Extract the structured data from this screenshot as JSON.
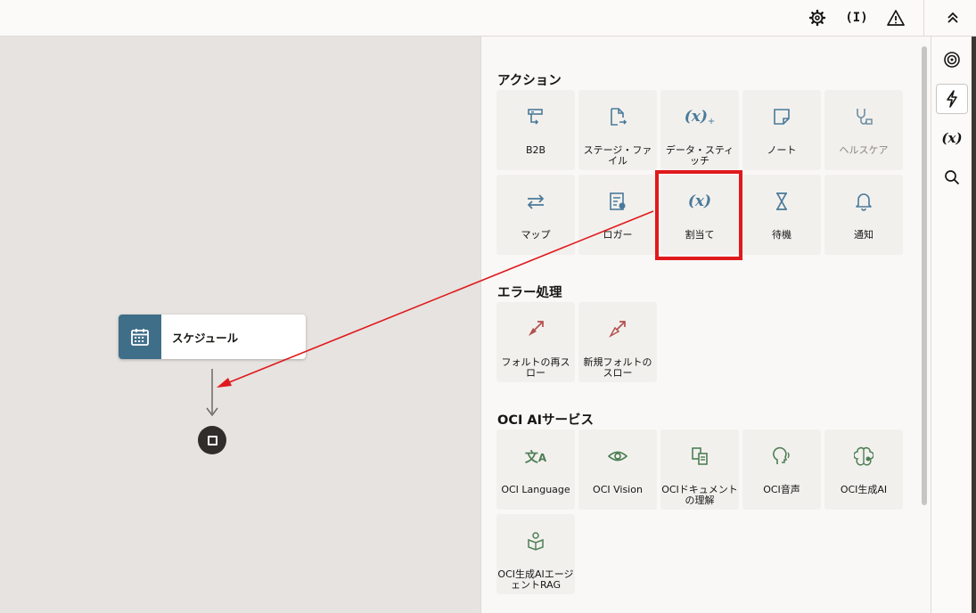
{
  "topbar": {
    "icons": [
      "gear-icon",
      "variable-icon",
      "warning-icon",
      "chevron-up-icon"
    ]
  },
  "canvas": {
    "node_label": "スケジュール"
  },
  "sections": {
    "actions": {
      "title": "アクション",
      "items": [
        {
          "label": "B2B",
          "icon": "b2b-icon"
        },
        {
          "label": "ステージ・ファイル",
          "icon": "stage-file-icon"
        },
        {
          "label": "データ・スティッチ",
          "icon": "data-stitch-icon"
        },
        {
          "label": "ノート",
          "icon": "note-icon"
        },
        {
          "label": "ヘルスケア",
          "icon": "healthcare-icon"
        },
        {
          "label": "マップ",
          "icon": "map-icon"
        },
        {
          "label": "ロガー",
          "icon": "logger-icon"
        },
        {
          "label": "割当て",
          "icon": "assign-icon"
        },
        {
          "label": "待機",
          "icon": "hourglass-icon"
        },
        {
          "label": "通知",
          "icon": "bell-icon"
        }
      ]
    },
    "errors": {
      "title": "エラー処理",
      "items": [
        {
          "label": "フォルトの再スロー",
          "icon": "rethrow-fault-icon"
        },
        {
          "label": "新規フォルトのスロー",
          "icon": "throw-fault-icon"
        }
      ]
    },
    "ai": {
      "title": "OCI AIサービス",
      "items": [
        {
          "label": "OCI Language",
          "icon": "translate-icon"
        },
        {
          "label": "OCI Vision",
          "icon": "eye-icon"
        },
        {
          "label": "OCIドキュメントの理解",
          "icon": "document-icon"
        },
        {
          "label": "OCI音声",
          "icon": "speech-icon"
        },
        {
          "label": "OCI生成AI",
          "icon": "brain-icon"
        },
        {
          "label": "OCI生成AIエージェントRAG",
          "icon": "agent-icon"
        }
      ]
    }
  },
  "rail": {
    "icons": [
      "target-icon",
      "bolt-icon",
      "variable-icon",
      "search-icon"
    ]
  },
  "colors": {
    "accent": "#3f6e88",
    "action_icon": "#4a7a9a",
    "error_icon": "#b2504d",
    "ai_icon": "#4d7f55",
    "highlight": "#e0191c"
  }
}
